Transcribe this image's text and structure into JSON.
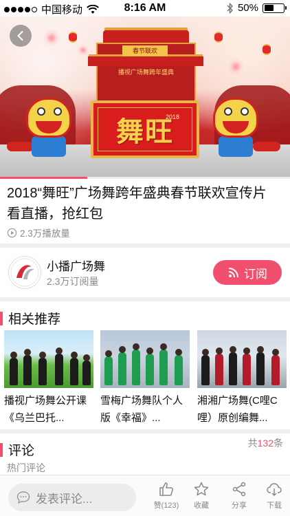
{
  "status_bar": {
    "carrier": "中国移动",
    "time": "8:16 AM",
    "battery": "50%",
    "battery_level": 0.5
  },
  "video": {
    "banner_text": "舞旺",
    "banner_year": "2018",
    "gate_plaque": "春节联欢",
    "gate_band": "播视广场舞跨年盛典",
    "progress": 0.3,
    "title_line1": "2018“舞旺”广场舞跨年盛典春节联欢宣传片",
    "title_line2": "看直播，抢红包",
    "play_count": "2.3万播放量"
  },
  "channel": {
    "name": "小播广场舞",
    "subscribers": "2.3万订阅量",
    "subscribe_label": "订阅"
  },
  "recommendations": {
    "header": "相关推荐",
    "items": [
      {
        "title_line1": "播视广场舞公开课",
        "title_line2": "《乌兰巴托..."
      },
      {
        "title_line1": "雪梅广场舞队个人",
        "title_line2": "版《幸福》..."
      },
      {
        "title_line1": "湘湘广场舞(C哩C",
        "title_line2": "哩）原创编舞..."
      }
    ]
  },
  "comments": {
    "header": "评论",
    "count_prefix": "共",
    "count": "132",
    "count_suffix": "条",
    "hot_label": "热门评论"
  },
  "bottom_bar": {
    "comment_placeholder": "发表评论...",
    "like_label": "赞(123)",
    "favorite_label": "收藏",
    "share_label": "分享",
    "download_label": "下载"
  },
  "colors": {
    "accent": "#f0506e",
    "muted_text": "#8a8a8a"
  },
  "icons": [
    "back-arrow-icon",
    "wifi-icon",
    "bluetooth-icon",
    "battery-icon",
    "play-circle-icon",
    "rss-icon",
    "chat-bubble-icon",
    "thumbs-up-icon",
    "star-icon",
    "share-icon",
    "cloud-download-icon"
  ]
}
